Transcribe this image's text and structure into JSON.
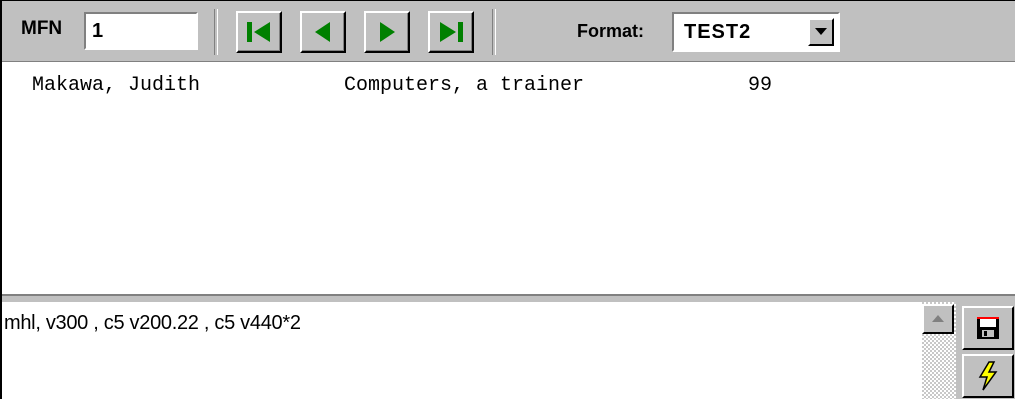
{
  "toolbar": {
    "mfn_label": "MFN",
    "mfn_value": "1",
    "format_label": "Format:",
    "format_value": "TEST2",
    "nav_buttons": [
      "first-record",
      "previous-record",
      "next-record",
      "last-record"
    ],
    "nav_icon_color": "#008000"
  },
  "output": {
    "author": "Makawa, Judith",
    "title": "Computers, a trainer",
    "number": "99"
  },
  "editor": {
    "format_text": "mhl, v300 , c5 v200.22 , c5 v440*2"
  },
  "side": {
    "icons": [
      "save-icon",
      "lightning-icon"
    ],
    "lightning_color": "#ffff00"
  }
}
